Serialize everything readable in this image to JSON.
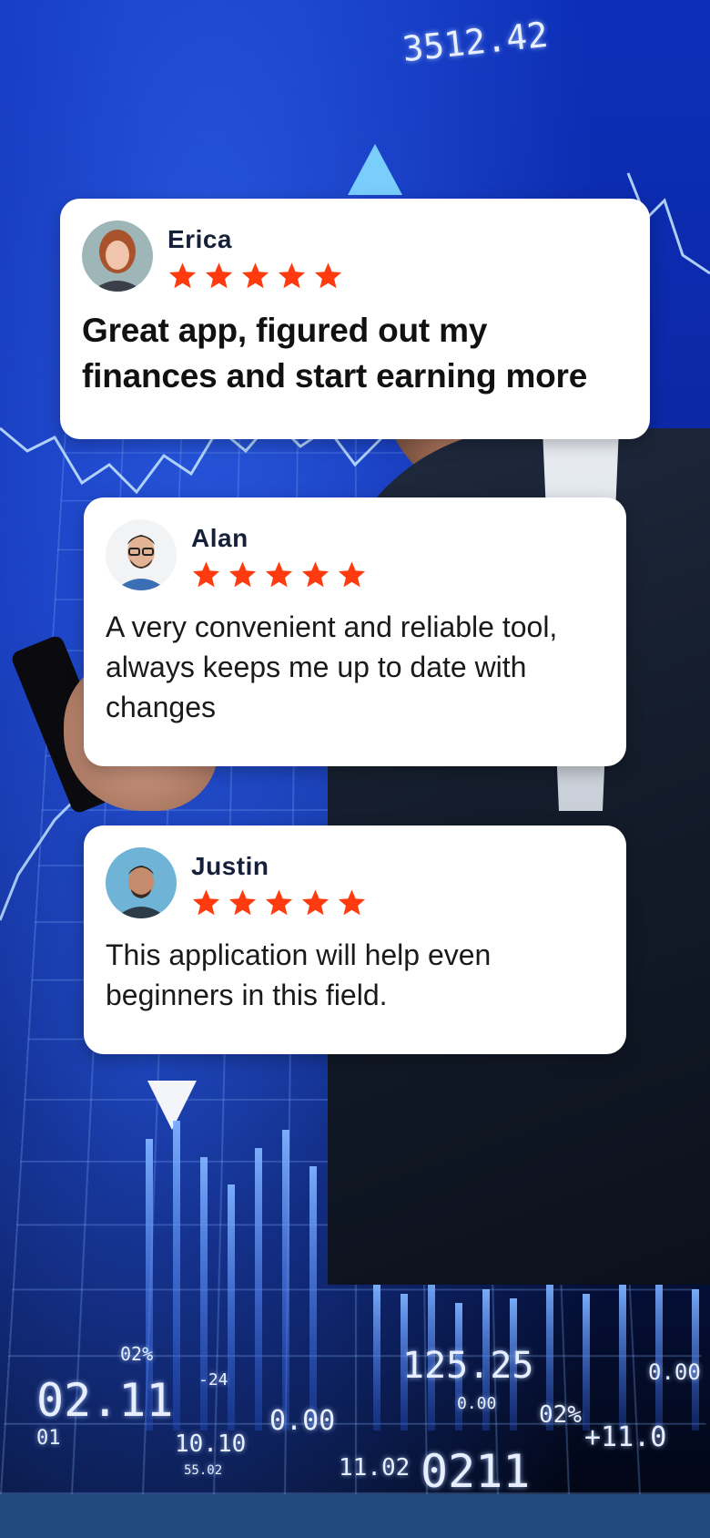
{
  "background": {
    "ticker_top": "3512.42",
    "tickers": [
      "02.11",
      "0.00",
      "02%",
      "125.25",
      "0.00",
      "10.10",
      "0.00",
      "11.02",
      "02%",
      "+11.0",
      "0211",
      "01",
      "-24",
      "55.02"
    ]
  },
  "colors": {
    "star": "#ff3a0f",
    "card_bg": "#ffffff",
    "name_text": "#17203a",
    "bottom_bar": "#234a7c"
  },
  "reviews": [
    {
      "name": "Erica",
      "rating": 5,
      "avatar_icon": "woman-avatar-icon",
      "text": "Great app, figured out my finances and start earning more"
    },
    {
      "name": "Alan",
      "rating": 5,
      "avatar_icon": "man-glasses-avatar-icon",
      "text": "A very convenient and reliable tool, always keeps me up to date with changes"
    },
    {
      "name": "Justin",
      "rating": 5,
      "avatar_icon": "man-avatar-icon",
      "text": "This application will help even beginners in this field."
    }
  ]
}
